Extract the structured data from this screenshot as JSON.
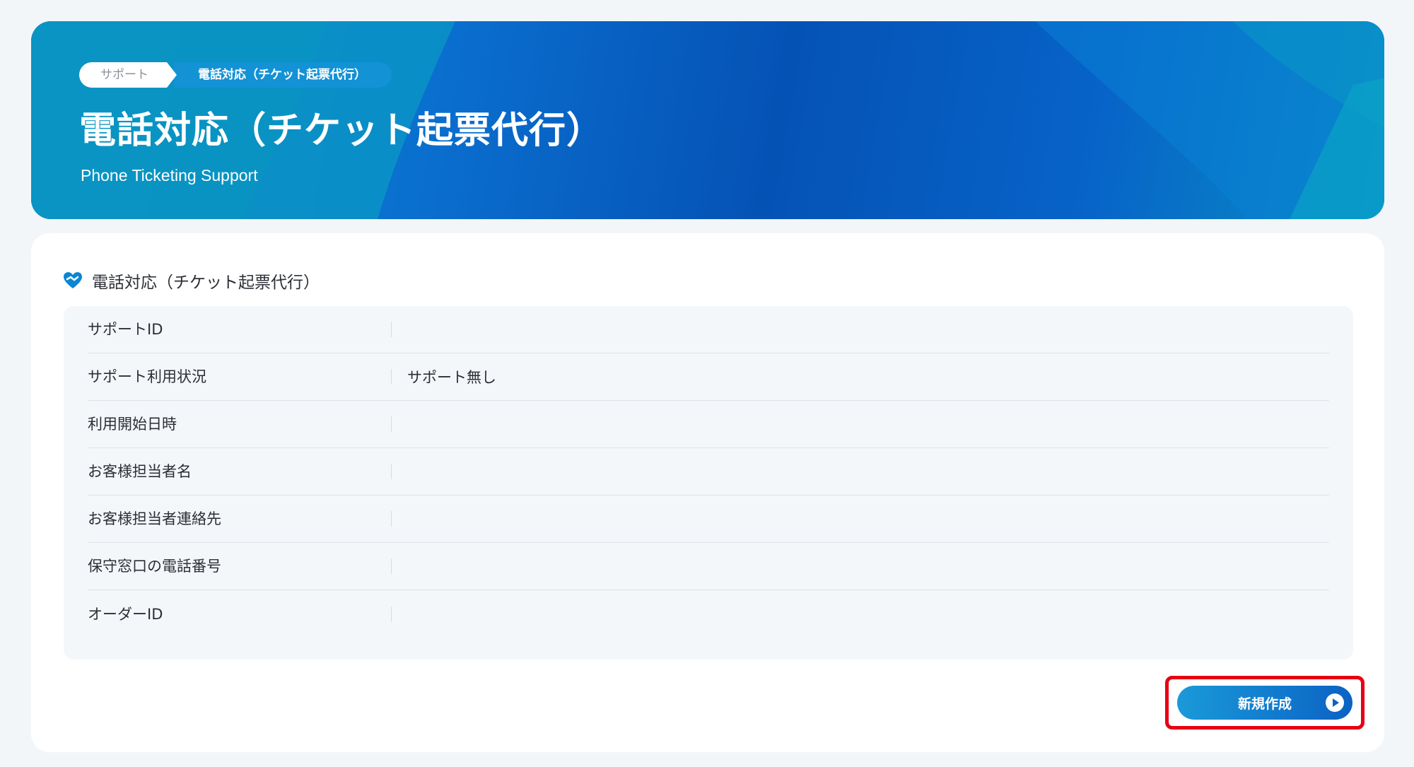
{
  "breadcrumb": {
    "items": [
      "サポート",
      "電話対応（チケット起票代行）"
    ]
  },
  "hero": {
    "title": "電話対応（チケット起票代行）",
    "subtitle": "Phone Ticketing Support"
  },
  "section": {
    "title": "電話対応（チケット起票代行）",
    "icon": "heart-handshake-icon"
  },
  "info": {
    "rows": [
      {
        "label": "サポートID",
        "value": ""
      },
      {
        "label": "サポート利用状況",
        "value": "サポート無し"
      },
      {
        "label": "利用開始日時",
        "value": ""
      },
      {
        "label": "お客様担当者名",
        "value": ""
      },
      {
        "label": "お客様担当者連絡先",
        "value": ""
      },
      {
        "label": "保守窓口の電話番号",
        "value": ""
      },
      {
        "label": "オーダーID",
        "value": ""
      }
    ]
  },
  "actions": {
    "new_label": "新規作成"
  },
  "colors": {
    "accent": "#0b62c4",
    "highlight": "#e60012"
  }
}
